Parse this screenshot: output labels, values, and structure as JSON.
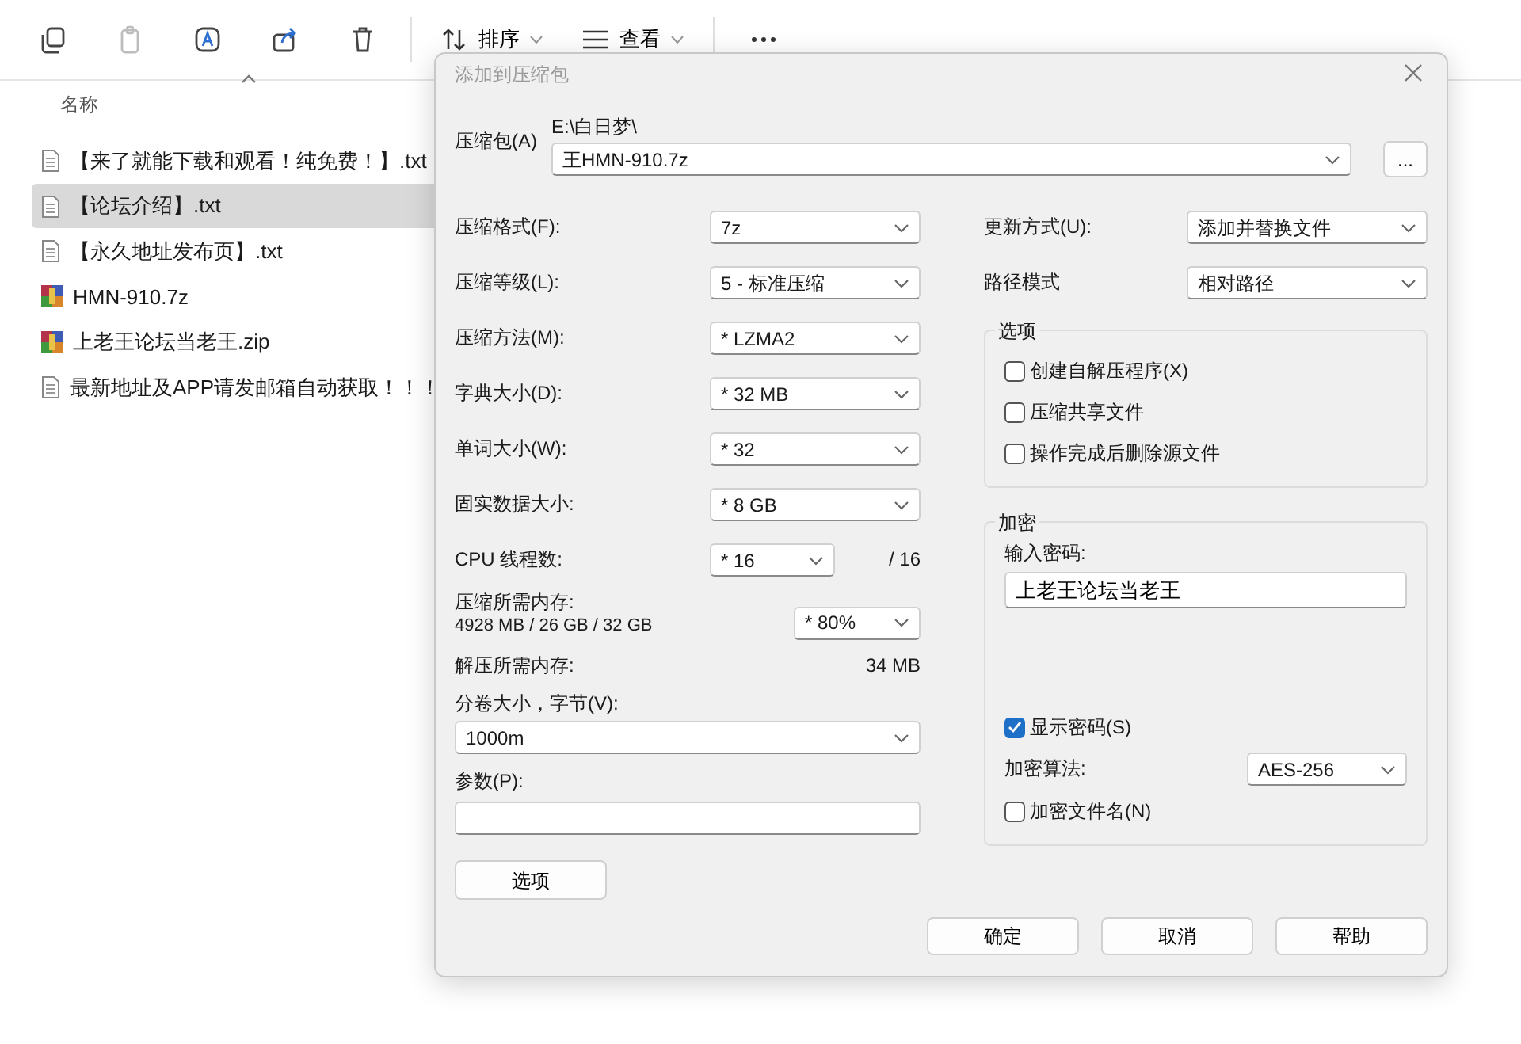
{
  "toolbar": {
    "icon_buttons": [
      {
        "kind": "copy",
        "disabled": false
      },
      {
        "kind": "paste",
        "disabled": true
      },
      {
        "kind": "rename",
        "disabled": false
      },
      {
        "kind": "share",
        "disabled": false
      },
      {
        "kind": "delete",
        "disabled": false
      }
    ],
    "menus": [
      {
        "kind": "sort",
        "label": "排序"
      },
      {
        "kind": "view",
        "label": "查看"
      }
    ]
  },
  "file_list": {
    "column": "名称",
    "files": [
      {
        "name": "【来了就能下载和观看！纯免费！】.txt",
        "kind": "text",
        "selected": false
      },
      {
        "name": "【论坛介绍】.txt",
        "kind": "text",
        "selected": true
      },
      {
        "name": "【永久地址发布页】.txt",
        "kind": "text",
        "selected": false
      },
      {
        "name": "HMN-910.7z",
        "kind": "archive",
        "selected": false
      },
      {
        "name": "上老王论坛当老王.zip",
        "kind": "archive",
        "selected": false
      },
      {
        "name": "最新地址及APP请发邮箱自动获取！！！",
        "kind": "text",
        "selected": false
      }
    ]
  },
  "dialog": {
    "title": "添加到压缩包",
    "archive": {
      "label": "压缩包(A)",
      "path": "E:\\白日梦\\",
      "value": "王HMN-910.7z",
      "browse": "..."
    },
    "left_fields": [
      {
        "label": "压缩格式(F):",
        "value": "7z"
      },
      {
        "label": "压缩等级(L):",
        "value": "5 - 标准压缩"
      },
      {
        "label": "压缩方法(M):",
        "value": "* LZMA2"
      },
      {
        "label": "字典大小(D):",
        "value": "* 32 MB"
      },
      {
        "label": "单词大小(W):",
        "value": "* 32"
      },
      {
        "label": "固实数据大小:",
        "value": "* 8 GB"
      }
    ],
    "threads": {
      "label": "CPU 线程数:",
      "value": "* 16",
      "total": "/ 16"
    },
    "memory": {
      "label": "压缩所需内存:",
      "detail": "4928 MB / 26 GB / 32 GB",
      "value": "* 80%"
    },
    "decompress_memory": {
      "label": "解压所需内存:",
      "value": "34 MB"
    },
    "volume": {
      "label": "分卷大小，字节(V):",
      "value": "1000m"
    },
    "parameters": {
      "label": "参数(P):"
    },
    "options_button": "选项",
    "right_fields": [
      {
        "label": "更新方式(U):",
        "value": "添加并替换文件"
      },
      {
        "label": "路径模式",
        "value": "相对路径"
      }
    ],
    "options_group": {
      "title": "选项",
      "checkboxes": [
        {
          "label": "创建自解压程序(X)",
          "checked": false
        },
        {
          "label": "压缩共享文件",
          "checked": false
        },
        {
          "label": "操作完成后删除源文件",
          "checked": false
        }
      ]
    },
    "encryption": {
      "title": "加密",
      "password_label": "输入密码:",
      "password": "上老王论坛当老王",
      "show_password": {
        "label": "显示密码(S)",
        "checked": true
      },
      "method_label": "加密算法:",
      "method": "AES-256",
      "encrypt_names": {
        "label": "加密文件名(N)",
        "checked": false
      }
    },
    "buttons": [
      "确定",
      "取消",
      "帮助"
    ]
  }
}
